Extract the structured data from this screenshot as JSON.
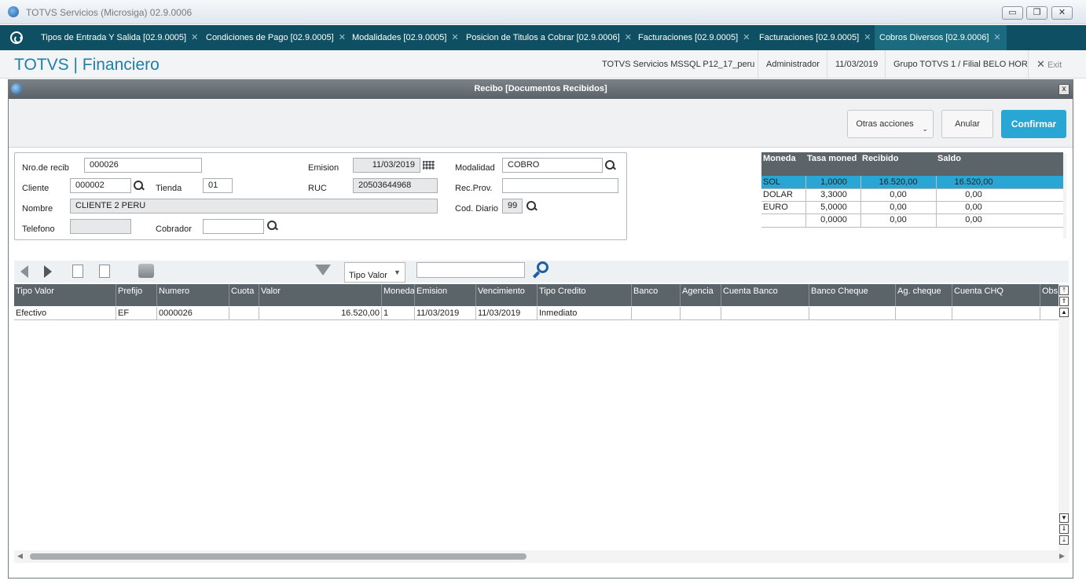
{
  "window": {
    "title": "TOTVS Servicios (Microsiga) 02.9.0006"
  },
  "tabs": [
    {
      "label": "Tipos de Entrada Y Salida [02.9.0005]"
    },
    {
      "label": "Condiciones de Pago [02.9.0005]"
    },
    {
      "label": "Modalidades [02.9.0005]"
    },
    {
      "label": "Posicion de Titulos a Cobrar [02.9.0006]"
    },
    {
      "label": "Facturaciones [02.9.0005]"
    },
    {
      "label": "Facturaciones [02.9.0005]"
    },
    {
      "label": "Cobros Diversos [02.9.0006]"
    }
  ],
  "app_header": {
    "brand": "TOTVS | Financiero",
    "server": "TOTVS Servicios MSSQL P12_17_peru",
    "user": "Administrador",
    "date": "11/03/2019",
    "group": "Grupo TOTVS 1 / Filial BELO HOR",
    "exit": "Exit"
  },
  "dialog": {
    "title": "Recibo [Documentos Recibidos]",
    "close": "x"
  },
  "toolbar": {
    "other_actions": "Otras acciones",
    "cancel": "Anular",
    "confirm": "Confirmar"
  },
  "form": {
    "nro_recib": {
      "label": "Nro.de recib",
      "value": "000026"
    },
    "cliente": {
      "label": "Cliente",
      "value": "000002"
    },
    "tienda": {
      "label": "Tienda",
      "value": "01"
    },
    "nombre": {
      "label": "Nombre",
      "value": "CLIENTE 2 PERU"
    },
    "telefono": {
      "label": "Telefono",
      "value": ""
    },
    "cobrador": {
      "label": "Cobrador",
      "value": ""
    },
    "emision": {
      "label": "Emision",
      "value": "11/03/2019"
    },
    "ruc": {
      "label": "RUC",
      "value": "20503644968"
    },
    "modalidad": {
      "label": "Modalidad",
      "value": "COBRO"
    },
    "rec_prov": {
      "label": "Rec.Prov.",
      "value": ""
    },
    "cod_diario": {
      "label": "Cod. Diario",
      "value": "99"
    }
  },
  "currency_table": {
    "headers": [
      "Moneda",
      "Tasa moned",
      "Recibido",
      "Saldo"
    ],
    "rows": [
      [
        "SOL",
        "1,0000",
        "16.520,00",
        "16.520,00"
      ],
      [
        "DOLAR",
        "3,3000",
        "0,00",
        "0,00"
      ],
      [
        "EURO",
        "5,0000",
        "0,00",
        "0,00"
      ],
      [
        "",
        "0,0000",
        "0,00",
        "0,00"
      ]
    ]
  },
  "filter": {
    "field": "Tipo Valor",
    "search": ""
  },
  "grid": {
    "headers": [
      "Tipo Valor",
      "Prefijo",
      "Numero",
      "Cuota",
      "Valor",
      "Moneda",
      "Emision",
      "Vencimiento",
      "Tipo Credito",
      "Banco",
      "Agencia",
      "Cuenta Banco",
      "Banco Cheque",
      "Ag. cheque",
      "Cuenta CHQ",
      "Obs"
    ],
    "rows": [
      [
        "Efectivo",
        "EF",
        "0000026",
        "",
        "16.520,00",
        "1",
        "11/03/2019",
        "11/03/2019",
        "Inmediato",
        "",
        "",
        "",
        "",
        "",
        "",
        ""
      ]
    ]
  },
  "colors": {
    "tabbar": "#0f4f63",
    "brand": "#1e7fa8",
    "primary": "#2aa6d4",
    "selected_row": "#2aa6d4",
    "grid_header": "#5b6469"
  }
}
